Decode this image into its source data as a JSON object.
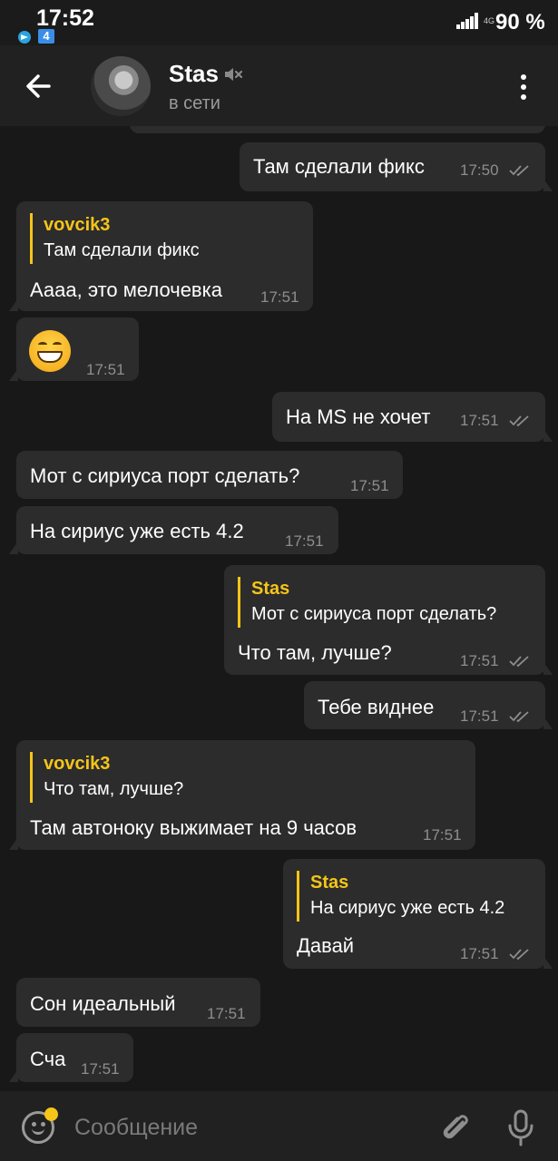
{
  "status_bar": {
    "time": "17:52",
    "battery": "90 %",
    "network_tag": "4G"
  },
  "header": {
    "name": "Stas",
    "status": "в сети"
  },
  "messages": [
    {
      "id": "m0",
      "direction": "out",
      "text": "Там сделали фикс",
      "time": "17:50",
      "read": true
    },
    {
      "id": "m1",
      "direction": "in",
      "reply_to": {
        "name": "vovcik3",
        "text": "Там сделали фикс"
      },
      "text": "Аааа, это мелочевка",
      "time": "17:51"
    },
    {
      "id": "m2",
      "direction": "in",
      "emoji": "grinning-face",
      "time": "17:51"
    },
    {
      "id": "m3",
      "direction": "out",
      "text": "На MS не хочет",
      "time": "17:51",
      "read": true
    },
    {
      "id": "m4",
      "direction": "in",
      "text": "Мот с сириуса порт сделать?",
      "time": "17:51"
    },
    {
      "id": "m5",
      "direction": "in",
      "text": "На сириус уже есть 4.2",
      "time": "17:51"
    },
    {
      "id": "m6",
      "direction": "out",
      "reply_to": {
        "name": "Stas",
        "text": "Мот с сириуса порт сделать?"
      },
      "text": "Что там, лучше?",
      "time": "17:51",
      "read": true
    },
    {
      "id": "m7",
      "direction": "out",
      "text": "Тебе виднее",
      "time": "17:51",
      "read": true
    },
    {
      "id": "m8",
      "direction": "in",
      "reply_to": {
        "name": "vovcik3",
        "text": "Что там, лучше?"
      },
      "text": "Там автоноку выжимает на 9 часов",
      "time": "17:51"
    },
    {
      "id": "m9",
      "direction": "out",
      "reply_to": {
        "name": "Stas",
        "text": "На сириус уже есть 4.2"
      },
      "text": "Давай",
      "time": "17:51",
      "read": true
    },
    {
      "id": "m10",
      "direction": "in",
      "text": "Сон идеальный",
      "time": "17:51"
    },
    {
      "id": "m11",
      "direction": "in",
      "text": "Сча",
      "time": "17:51"
    }
  ],
  "input": {
    "placeholder": "Сообщение"
  },
  "icons": {
    "back": "arrow-left-icon",
    "mute": "muted-speaker-icon",
    "menu": "more-vertical-icon",
    "emoji": "smile-icon",
    "attach": "paperclip-icon",
    "mic": "microphone-icon"
  },
  "colors": {
    "accent": "#f5c518",
    "bubble": "#2c2c2c",
    "background": "#181818",
    "header": "#212121"
  }
}
